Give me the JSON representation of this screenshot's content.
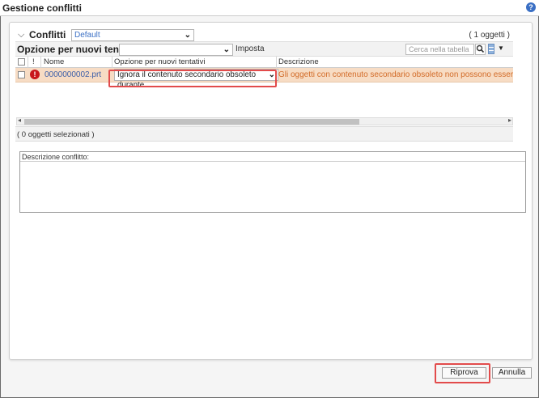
{
  "window": {
    "title": "Gestione conflitti",
    "help_icon": "help-icon",
    "help_glyph": "?"
  },
  "conflicts": {
    "header_title": "Conflitti",
    "filter_value": "Default",
    "object_count": "( 1 oggetti )"
  },
  "toolbar": {
    "retry_option_label": "Opzione per nuovi tentativi",
    "retry_option_value": "",
    "apply_label": "Imposta",
    "search_placeholder": "Cerca nella tabella"
  },
  "table": {
    "columns": {
      "attention": "!",
      "name": "Nome",
      "retry_option": "Opzione per nuovi tentativi",
      "description": "Descrizione"
    },
    "rows": [
      {
        "name": "0000000002.prt",
        "status_icon": "error-icon",
        "status_glyph": "!",
        "retry_option": "Ignora il contenuto secondario obsoleto durante",
        "description": "Gli oggetti con contenuto secondario obsoleto non possono essere sottoposti"
      }
    ],
    "selection_status": "( 0 oggetti selezionati )"
  },
  "conflict_description": {
    "label": "Descrizione conflitto:",
    "text": ""
  },
  "buttons": {
    "retry": "Riprova",
    "cancel": "Annulla"
  },
  "colors": {
    "row_highlight": "#f7dcc4",
    "highlight_box": "#e24b4b",
    "link_blue": "#3b5ea8",
    "error_red": "#c8171c",
    "description_orange": "#d26b28"
  }
}
